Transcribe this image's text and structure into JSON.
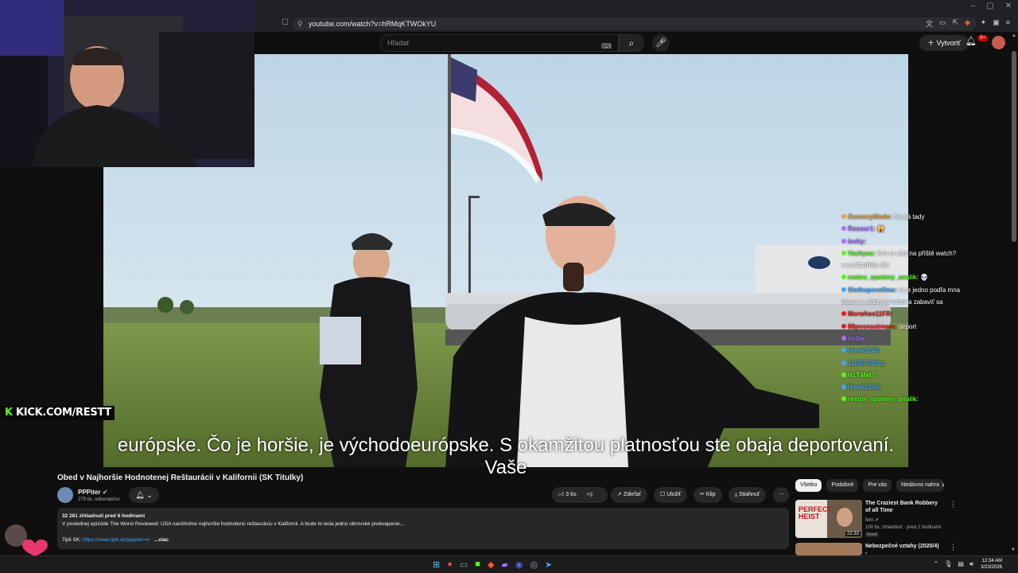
{
  "browser": {
    "url": "youtube.com/watch?v=hRMqKTWOkYU",
    "window_controls": [
      "–",
      "▢",
      "✕"
    ]
  },
  "yt_header": {
    "search_placeholder": "Hľadať",
    "create_label": "Vytvoriť",
    "notif_count": "9+"
  },
  "caption": "európske. Čo je horšie, je východoeurópske. S okamžitou platnosťou ste obaja deportovaní. Vaše",
  "overlay": {
    "kick_prefix": "K",
    "kick_text": "KICK.COM/RESTT"
  },
  "chat": [
    {
      "user": "GumovyMedo:",
      "msg": "čau já tady",
      "color": "#e8a33d"
    },
    {
      "user": "Rosaur1:",
      "msg": "🙀",
      "color": "#a970ff"
    },
    {
      "user": "lovky:",
      "msg": "",
      "color": "#a970ff"
    },
    {
      "user": "Vachyas:",
      "msg": "foto si ulož na příště watch?",
      "color": "#53fc18"
    },
    {
      "user": "",
      "msg": "v=eVGtbRSn-5U",
      "color": "#ffffff"
    },
    {
      "user": "restov_spoteny_analik:",
      "msg": "💀",
      "color": "#53fc18"
    },
    {
      "user": "Slothspovellme:",
      "msg": "to je jedno podľa mna",
      "color": "#3ea6ff"
    },
    {
      "user": "",
      "msg": "hlavne s dobrymi ludmi a zabaviť sa",
      "color": "#ffffff"
    },
    {
      "user": "Morwhee11FR:",
      "msg": "",
      "color": "#e91916"
    },
    {
      "user": "88posnastreem:",
      "msg": "deport",
      "color": "#e91916"
    },
    {
      "user": "ricibe:",
      "msg": "",
      "color": "#a970ff"
    },
    {
      "user": "Hawk9248:",
      "msg": "",
      "color": "#3ea6ff"
    },
    {
      "user": "11BETON11:",
      "msg": "",
      "color": "#3ea6ff"
    },
    {
      "user": "H1T4N47:",
      "msg": "",
      "color": "#53fc18"
    },
    {
      "user": "Hawk9248:",
      "msg": "",
      "color": "#3ea6ff"
    },
    {
      "user": "restov_spoteny_analik:",
      "msg": "",
      "color": "#53fc18"
    }
  ],
  "video_meta": {
    "title": "Obed v Najhoršie Hodnotenej Reštaurácii v Kalifornii (SK Titulky)",
    "channel": "PPPiter",
    "subscribers": "279 tis. odberateľov",
    "likes": "3 tis.",
    "share": "Zdieľať",
    "save": "Uložiť",
    "clip": "Klip",
    "download": "Stiahnuť",
    "views_line": "32 261 zhliadnutí  pred 6 hodinami",
    "description": "V poslednej epizóde The Worst Reviewed: USA navštívime najhoršie hodnotenú reštauráciu v Kalifornii. A bude to teda jedno obrovské prekvapenie...",
    "tipli_label": "Tipli SK:",
    "tipli_link": "https://www.tipli.sk/pppeter=n",
    "more": "...viac"
  },
  "chips": [
    "Všetko",
    "Podobné",
    "Pre vás",
    "Nedávno nahra"
  ],
  "recs": [
    {
      "title": "The Craziest Bank Robbery of all Time",
      "channel": "fern",
      "meta": "100 tis. zhliadnutí · pred 2 hodinami",
      "badge": "Nové",
      "duration": "22:33",
      "thumb_text": "PERFECT HEIST"
    },
    {
      "title": "Nebezpečné vztahy (2020/4) -",
      "channel": "",
      "meta": "",
      "badge": "",
      "duration": "",
      "thumb_text": ""
    }
  ],
  "taskbar": {
    "time": "12:34 AM",
    "date": "3/23/2026"
  },
  "colors": {
    "yt_bg": "#0f0f0f",
    "chip_bg": "#272727",
    "kick_green": "#53fc18",
    "link_blue": "#3ea6ff"
  }
}
